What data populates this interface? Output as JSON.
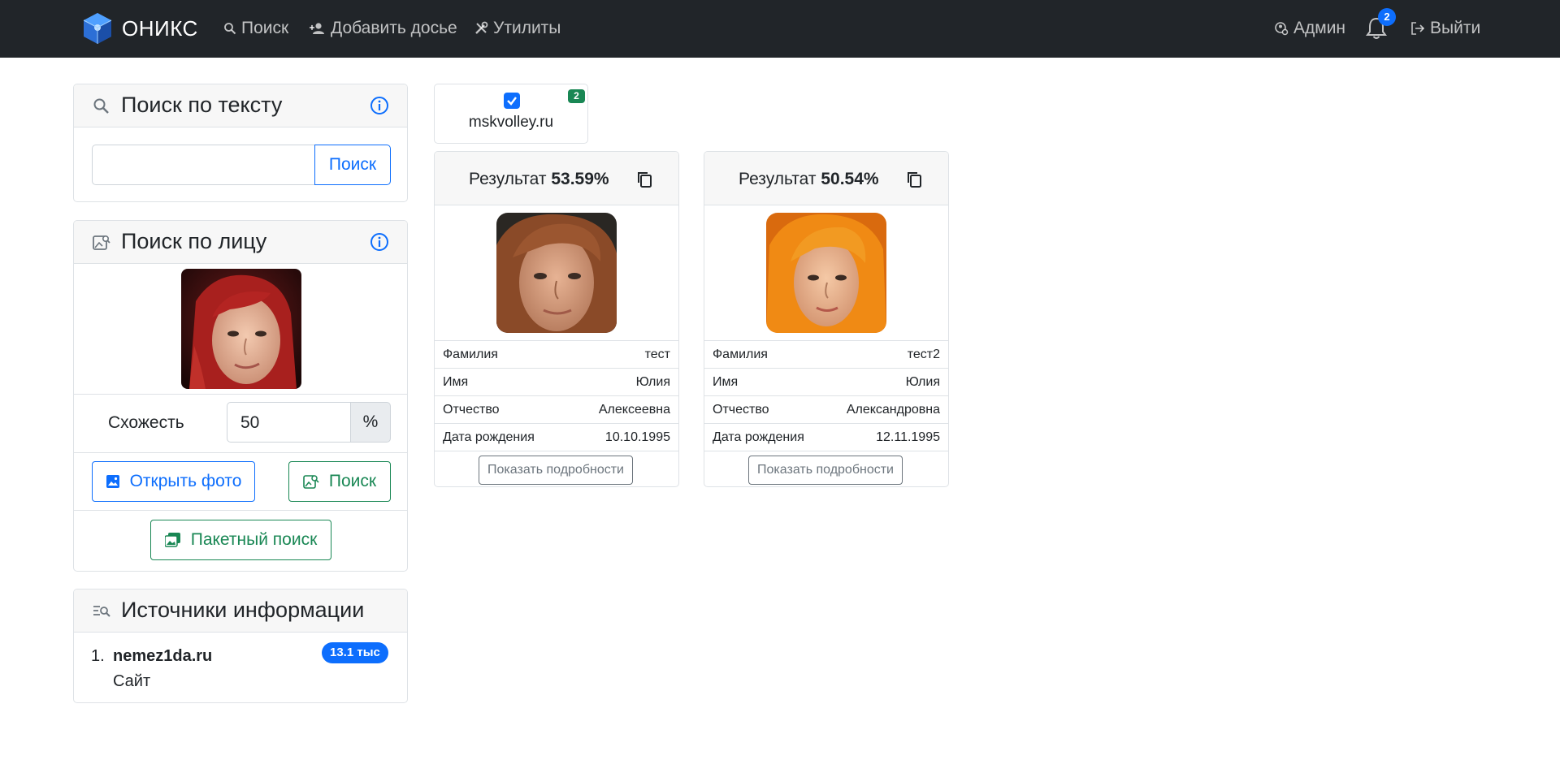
{
  "navbar": {
    "brand": "ОНИКС",
    "links": {
      "search": "Поиск",
      "add_dossier": "Добавить досье",
      "utilities": "Утилиты"
    },
    "user": "Админ",
    "notifications_count": "2",
    "logout": "Выйти"
  },
  "text_search": {
    "title": "Поиск по тексту",
    "input_value": "",
    "button": "Поиск"
  },
  "face_search": {
    "title": "Поиск по лицу",
    "similarity_label": "Схожесть",
    "similarity_value": "50",
    "similarity_unit": "%",
    "open_photo": "Открыть фото",
    "search": "Поиск",
    "batch_search": "Пакетный поиск"
  },
  "sources": {
    "title": "Источники информации",
    "items": [
      {
        "number": "1.",
        "name": "nemez1da.ru",
        "type": "Сайт",
        "count": "13.1 тыс"
      }
    ]
  },
  "source_filter": {
    "label": "mskvolley.ru",
    "count": "2",
    "checked": true
  },
  "results": [
    {
      "title_prefix": "Результат",
      "score": "53.59%",
      "fields": [
        {
          "key": "Фамилия",
          "value": "тест"
        },
        {
          "key": "Имя",
          "value": "Юлия"
        },
        {
          "key": "Отчество",
          "value": "Алексеевна"
        },
        {
          "key": "Дата рождения",
          "value": "10.10.1995"
        }
      ],
      "details_button": "Показать подробности"
    },
    {
      "title_prefix": "Результат",
      "score": "50.54%",
      "fields": [
        {
          "key": "Фамилия",
          "value": "тест2"
        },
        {
          "key": "Имя",
          "value": "Юлия"
        },
        {
          "key": "Отчество",
          "value": "Александровна"
        },
        {
          "key": "Дата рождения",
          "value": "12.11.1995"
        }
      ],
      "details_button": "Показать подробности"
    }
  ],
  "colors": {
    "navbar": "#212529",
    "primary": "#0d6efd",
    "success": "#198754",
    "secondary": "#6c757d"
  }
}
